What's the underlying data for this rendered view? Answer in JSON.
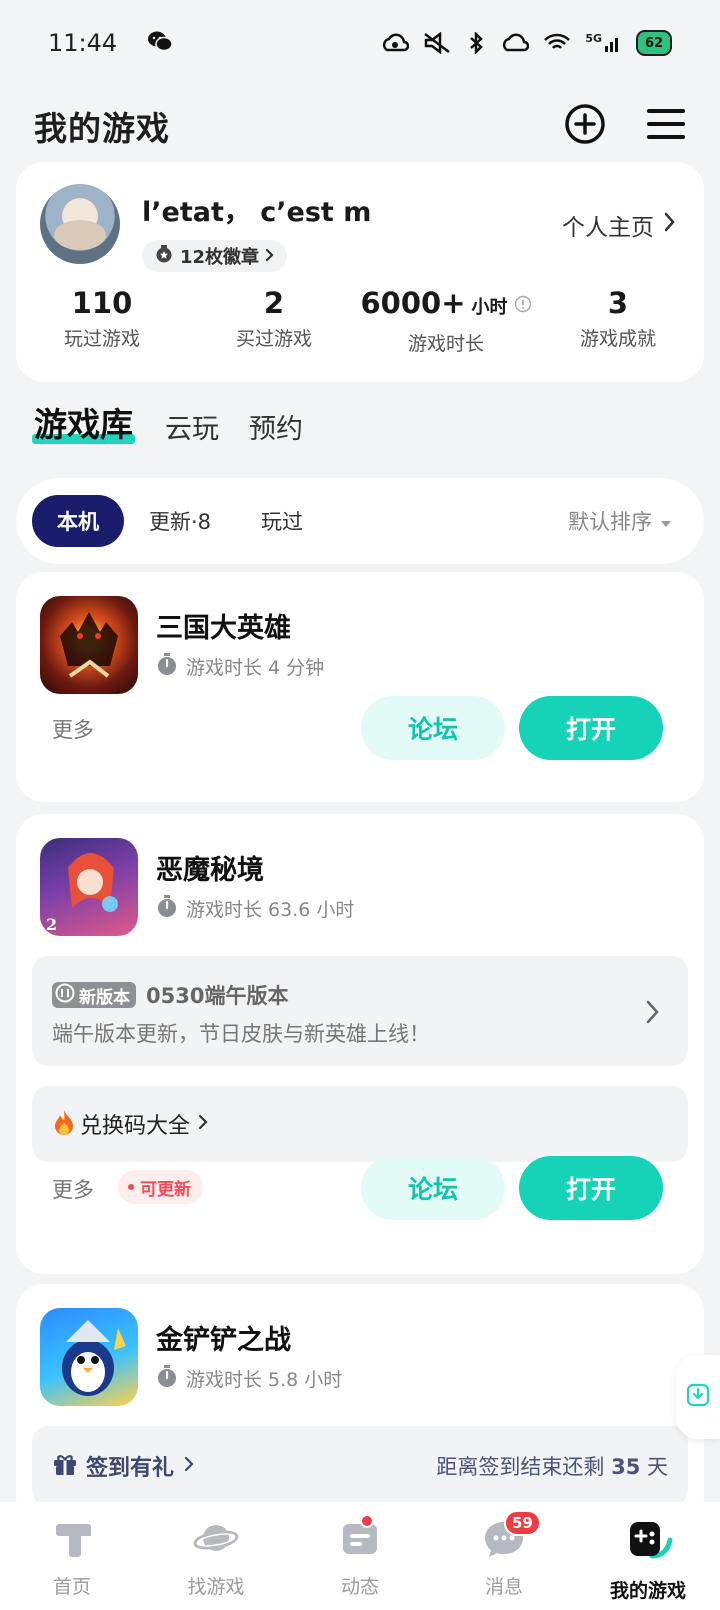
{
  "status_bar": {
    "time": "11:44",
    "network": "5G",
    "battery": "62"
  },
  "header": {
    "title": "我的游戏"
  },
  "profile": {
    "username": "l’etat， c’est m",
    "badges": "12枚徽章",
    "homepage_link": "个人主页",
    "stats": [
      {
        "value": "110",
        "unit": "",
        "label": "玩过游戏"
      },
      {
        "value": "2",
        "unit": "",
        "label": "买过游戏"
      },
      {
        "value": "6000+",
        "unit": "小时",
        "label": "游戏时长"
      },
      {
        "value": "3",
        "unit": "",
        "label": "游戏成就"
      }
    ]
  },
  "library_tabs": [
    {
      "label": "游戏库",
      "active": true
    },
    {
      "label": "云玩"
    },
    {
      "label": "预约"
    }
  ],
  "filters": {
    "chips": [
      {
        "label": "本机",
        "active": true
      },
      {
        "label": "更新·8"
      },
      {
        "label": "玩过"
      }
    ],
    "sort": "默认排序"
  },
  "games": [
    {
      "name": "三国大英雄",
      "playtime": "游戏时长 4 分钟",
      "more": "更多",
      "forum": "论坛",
      "open": "打开"
    },
    {
      "name": "恶魔秘境",
      "playtime": "游戏时长 63.6 小时",
      "version_tag": "新版本",
      "version_title": "0530端午版本",
      "version_desc": "端午版本更新，节日皮肤与新英雄上线！",
      "redeem": "兑换码大全",
      "more": "更多",
      "update_tag": "可更新",
      "forum": "论坛",
      "open": "打开"
    },
    {
      "name": "金铲铲之战",
      "playtime": "游戏时长 5.8 小时",
      "checkin": "签到有礼",
      "countdown_prefix": "距离签到结束还剩",
      "countdown_days": "35",
      "countdown_unit": "天"
    }
  ],
  "bottom_nav": [
    {
      "label": "首页"
    },
    {
      "label": "找游戏"
    },
    {
      "label": "动态"
    },
    {
      "label": "消息",
      "count": "59"
    },
    {
      "label": "我的游戏",
      "active": true
    }
  ],
  "colors": {
    "accent": "#16d3b8",
    "chip_active": "#1a1d6b",
    "alert": "#f03b45"
  }
}
